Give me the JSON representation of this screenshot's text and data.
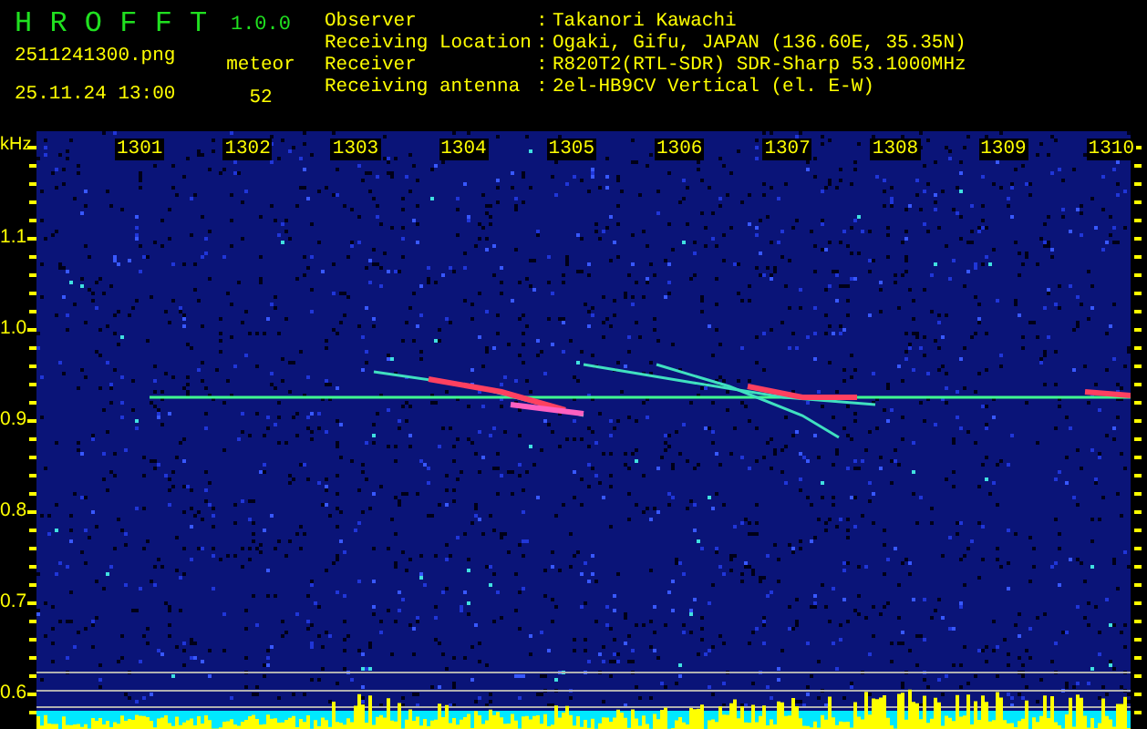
{
  "app": {
    "name": "H R O F F T",
    "version": "1.0.0"
  },
  "file": "2511241300.png",
  "datetime": "25.11.24 13:00",
  "meteor": {
    "label": "meteor",
    "count": "52"
  },
  "info": [
    {
      "label": "Observer",
      "separator": ":",
      "value": "Takanori Kawachi"
    },
    {
      "label": "Receiving Location",
      "separator": ":",
      "value": "Ogaki, Gifu, JAPAN (136.60E, 35.35N)"
    },
    {
      "label": "Receiver",
      "separator": ":",
      "value": "R820T2(RTL-SDR) SDR-Sharp 53.1000MHz"
    },
    {
      "label": "Receiving antenna",
      "separator": ":",
      "value": "2el-HB9CV Vertical (el. E-W)"
    }
  ],
  "plot": {
    "unit": "kHz",
    "time_labels": [
      "1301",
      "1302",
      "1303",
      "1304",
      "1305",
      "1306",
      "1307",
      "1308",
      "1309",
      "1310"
    ],
    "freq_labels": [
      "1.1",
      "1.0",
      "0.9",
      "0.8",
      "0.7",
      "0.6"
    ]
  }
}
